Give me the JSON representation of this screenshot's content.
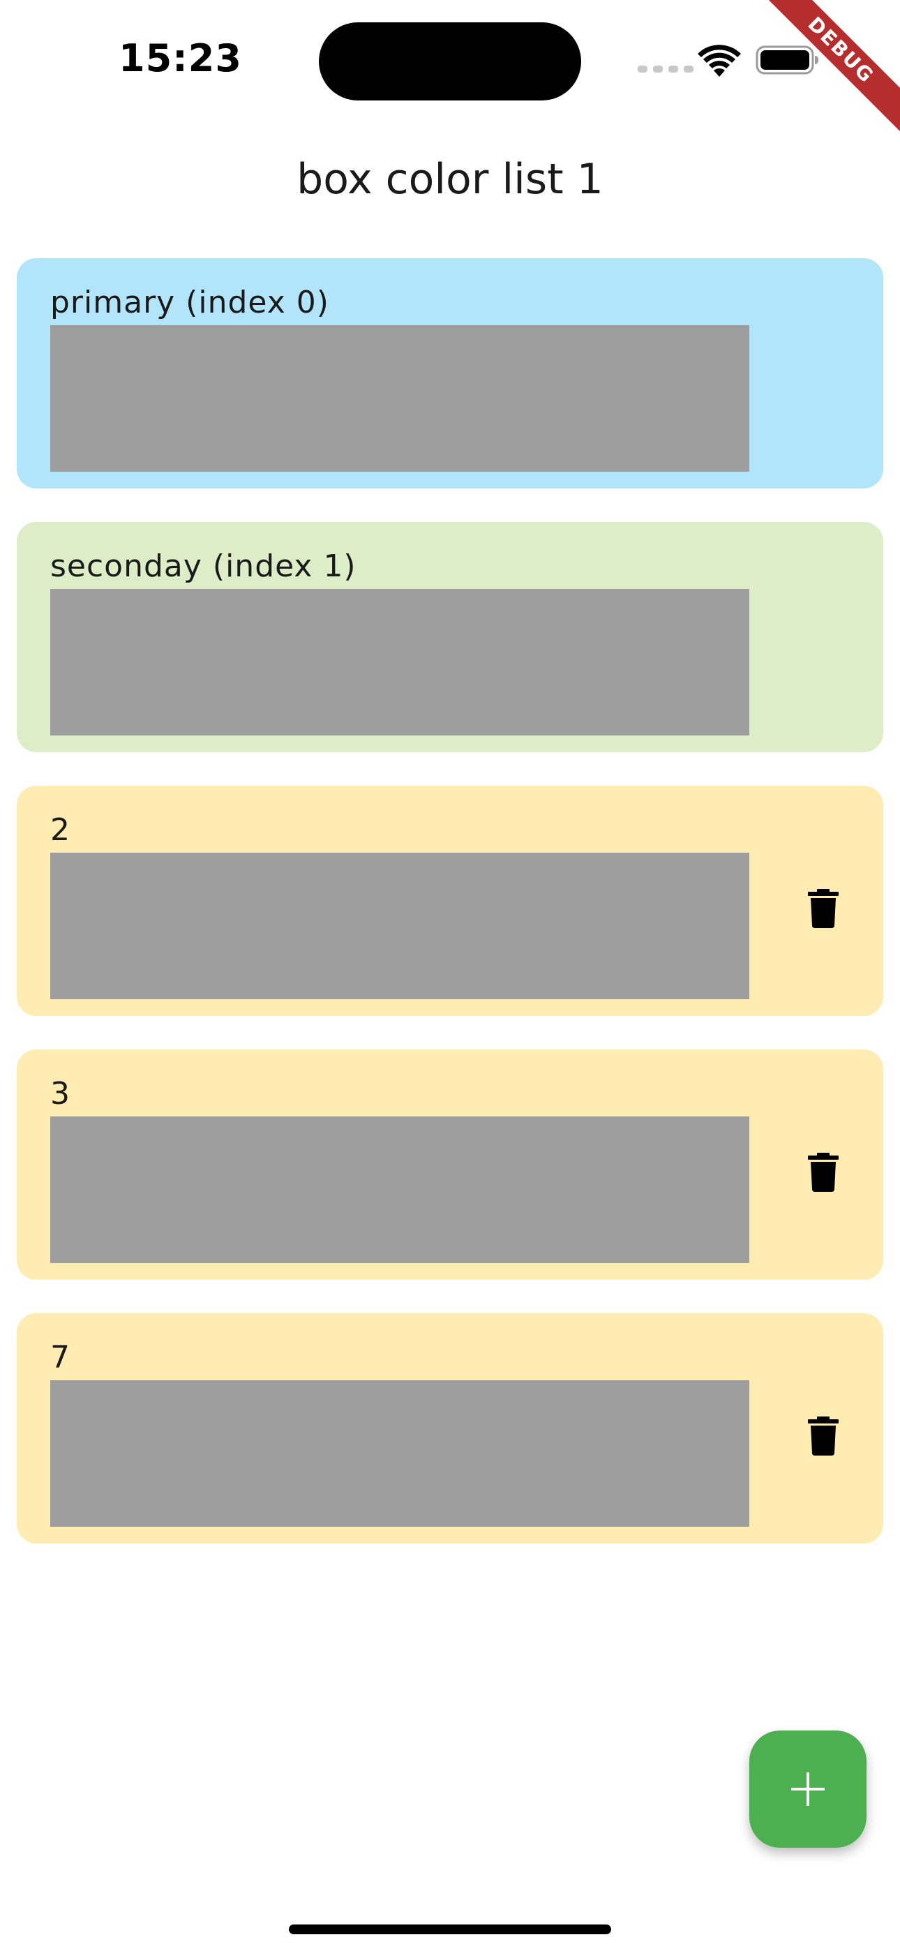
{
  "status_bar": {
    "time": "15:23",
    "debug_banner": "DEBUG"
  },
  "app_bar": {
    "title": "box color list 1"
  },
  "colors": {
    "primary_card": "#b3e5fa",
    "secondary_card": "#dcedc8",
    "extra_card": "#ffecb3",
    "swatch": "#9e9e9e",
    "fab": "#4caf50"
  },
  "cards": [
    {
      "label": "primary (index 0)",
      "deletable": false,
      "icon": null
    },
    {
      "label": "seconday (index 1)",
      "deletable": false,
      "icon": null
    },
    {
      "label": "2",
      "deletable": true,
      "icon": "trash-icon"
    },
    {
      "label": "3",
      "deletable": true,
      "icon": "trash-icon"
    },
    {
      "label": "7",
      "deletable": true,
      "icon": "trash-icon"
    }
  ],
  "fab": {
    "icon": "plus-icon"
  }
}
